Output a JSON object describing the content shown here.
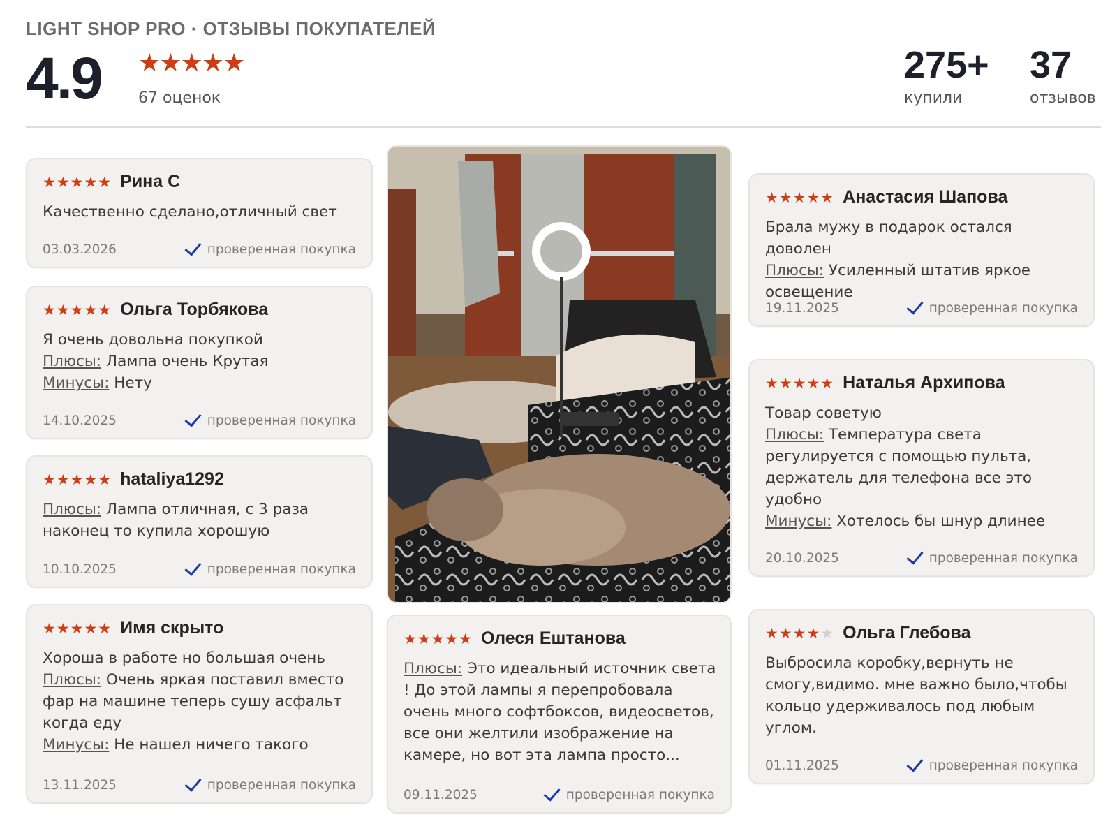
{
  "header": {
    "brand": "LIGHT SHOP PRO · ОТЗЫВЫ ПОКУПАТЕЛЕЙ",
    "rating": "4.9",
    "stars": "★★★★★",
    "rating_count": "67 оценок",
    "bought_num": "275+",
    "bought_label": "купили",
    "reviews_num": "37",
    "reviews_label": "отзывов"
  },
  "labels": {
    "pros": "Плюсы:",
    "cons": "Минусы:",
    "verified": "проверенная покупка"
  },
  "colors": {
    "star": "#cf3d14",
    "check": "#1c3aa9",
    "card_bg": "#f2f1ef"
  },
  "reviews": [
    {
      "stars": "★★★★★",
      "author": "Рина С",
      "text": "Качественно сделано,отличный свет",
      "pros": "",
      "cons": "",
      "date": "03.03.2026"
    },
    {
      "stars": "★★★★★",
      "author": "Ольга Торбякова",
      "text": "Я очень довольна покупкой",
      "pros": "Лампа очень Крутая",
      "cons": "Нету",
      "date": "14.10.2025"
    },
    {
      "stars": "★★★★★",
      "author": "hataliya1292",
      "text": "",
      "pros": "Лампа отличная, с 3 раза наконец то купила хорошую",
      "cons": "",
      "date": "10.10.2025"
    },
    {
      "stars": "★★★★★",
      "author": "Имя скрыто",
      "text": "Хороша в работе но большая очень",
      "pros": "Очень яркая поставил вместо фар на машине теперь сушу асфальт когда еду",
      "cons": "Не нашел ничего такого",
      "date": "13.11.2025"
    },
    {
      "stars": "★★★★★",
      "author": "Олеся Ештанова",
      "text": "",
      "pros": "Это идеальный источник света ! До этой лампы я перепробовала очень много софтбоксов, видеосветов, все они желтили изображение на камере, но вот эта лампа просто...",
      "cons": "",
      "date": "09.11.2025"
    },
    {
      "stars": "★★★★★",
      "author": "Анастасия Шапова",
      "text": "Брала мужу в подарок остался доволен",
      "pros": "Усиленный штатив яркое освещение",
      "cons": "",
      "date": "19.11.2025"
    },
    {
      "stars": "★★★★★",
      "author": "Наталья Архипова",
      "text": "Товар советую",
      "pros": "Температура света регулируется с помощью пульта, держатель для телефона все это удобно",
      "cons": "Хотелось бы шнур длинее",
      "date": "20.10.2025"
    },
    {
      "stars": "★★★★",
      "stars_off": "★",
      "author": "Ольга Глебова",
      "text": "Выбросила коробку,вернуть не смогу,видимо. мне важно было,чтобы кольцо удерживалось под любым углом.",
      "pros": "",
      "cons": "",
      "date": "01.11.2025"
    }
  ]
}
